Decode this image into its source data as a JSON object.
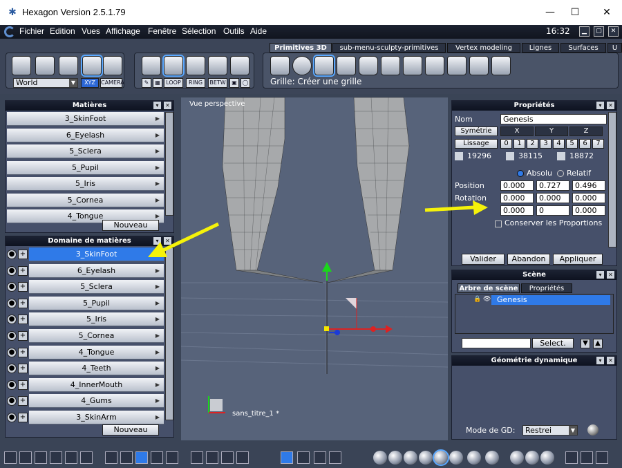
{
  "window": {
    "title": "Hexagon Version 2.5.1.79",
    "minimize": "—",
    "maximize": "☐",
    "close": "✕"
  },
  "menu": {
    "items": [
      "Fichier",
      "Edition",
      "Vues",
      "Affichage",
      "Fenêtre",
      "Sélection",
      "Outils",
      "Aide"
    ],
    "clock": "16:32"
  },
  "toolbar": {
    "coord_mode": "World",
    "buttons": [
      "XYZ",
      "CAMERA",
      "LOOP",
      "RING",
      "BETW"
    ],
    "tabs": [
      "Primitives 3D",
      "sub-menu-sculpty-primitives",
      "Vertex modeling",
      "Lignes",
      "Surfaces",
      "U"
    ],
    "grid_hint": "Grille: Créer une grille"
  },
  "materials_panel": {
    "title": "Matières",
    "items": [
      "3_SkinFoot",
      "6_Eyelash",
      "5_Sclera",
      "5_Pupil",
      "5_Iris",
      "5_Cornea",
      "4_Tongue"
    ],
    "new_button": "Nouveau"
  },
  "domain_panel": {
    "title": "Domaine de matières",
    "items": [
      "3_SkinFoot",
      "6_Eyelash",
      "5_Sclera",
      "5_Pupil",
      "5_Iris",
      "5_Cornea",
      "4_Tongue",
      "4_Teeth",
      "4_InnerMouth",
      "4_Gums",
      "3_SkinArm"
    ],
    "new_button": "Nouveau"
  },
  "viewport": {
    "label": "Vue perspective",
    "doc_name": "sans_titre_1 *"
  },
  "properties": {
    "title": "Propriétés",
    "name_label": "Nom",
    "name_value": "Genesis",
    "symmetry_label": "Symétrie",
    "axes": [
      "X",
      "Y",
      "Z"
    ],
    "smoothing_label": "Lissage",
    "smoothing_levels": [
      "0",
      "1",
      "2",
      "3",
      "4",
      "5",
      "6",
      "7"
    ],
    "counts": [
      "19296",
      "38115",
      "18872"
    ],
    "absolute_label": "Absolu",
    "relative_label": "Relatif",
    "position_label": "Position",
    "position": [
      "0.000",
      "0.727",
      "0.496"
    ],
    "rotation_label": "Rotation",
    "rotation": [
      "0.000",
      "0.000",
      "0.000"
    ],
    "scale": [
      "0.000",
      "0",
      "0.000"
    ],
    "keep_proportions": "Conserver les Proportions",
    "validate": "Valider",
    "abort": "Abandon",
    "apply": "Appliquer"
  },
  "scene": {
    "title": "Scène",
    "tabs": [
      "Arbre de scène",
      "Propriétés"
    ],
    "tree_item": "Genesis",
    "select_button": "Select."
  },
  "dynamic_geometry": {
    "title": "Géométrie dynamique",
    "mode_label": "Mode de GD:",
    "mode_value": "Restrei"
  },
  "colors": {
    "accent": "#2f7ae8",
    "annotation_arrow": "#f5f20a",
    "panel": "#46506a"
  }
}
